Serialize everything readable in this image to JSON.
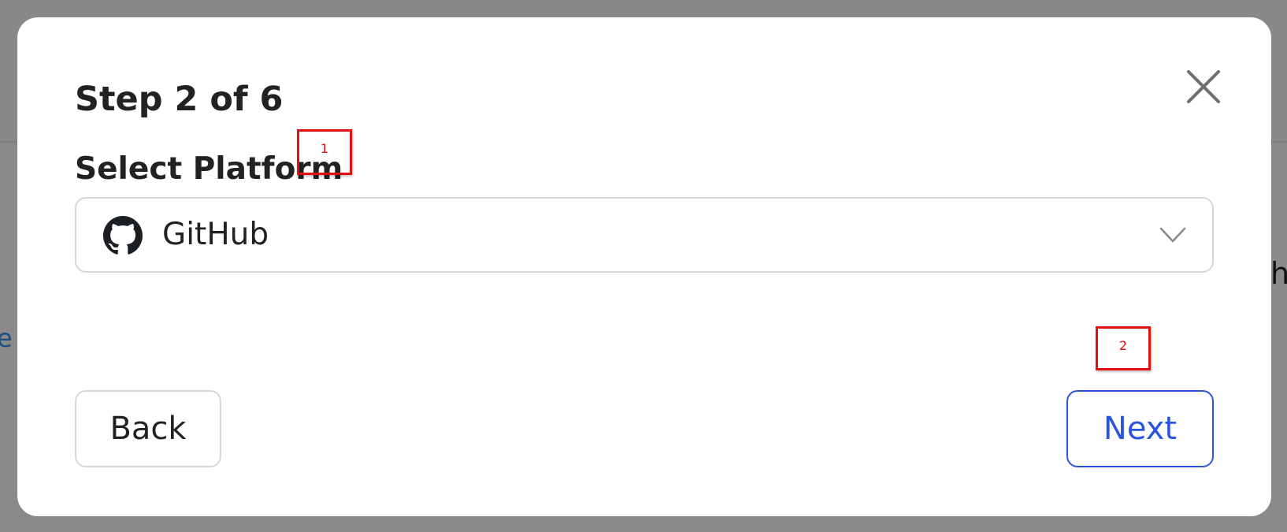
{
  "background": {
    "left_text": "e",
    "right_text": "h"
  },
  "modal": {
    "title": "Step 2 of 6",
    "close_icon": "close-icon",
    "field_label": "Select Platform",
    "platform_select": {
      "selected_value": "GitHub",
      "icon": "github-icon",
      "dropdown_icon": "chevron-down-icon"
    },
    "back_label": "Back",
    "next_label": "Next"
  },
  "annotations": {
    "marker_1": "1",
    "marker_2": "2"
  },
  "colors": {
    "accent": "#2a55e0",
    "marker": "#e01010",
    "text": "#222222",
    "border": "#d7d7d7",
    "overlay": "#8a8a8a"
  }
}
